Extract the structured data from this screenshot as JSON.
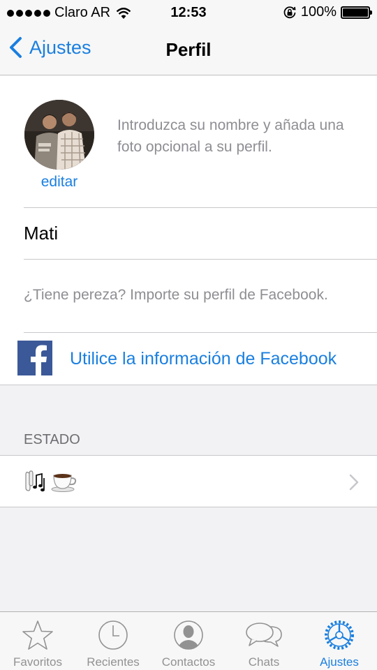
{
  "status_bar": {
    "carrier": "Claro AR",
    "time": "12:53",
    "battery": "100%",
    "battery_level": 1.0,
    "signal_dots": 5
  },
  "nav": {
    "back_label": "Ajustes",
    "title": "Perfil"
  },
  "profile": {
    "edit_label": "editar",
    "hint": "Introduzca su nombre y añada una foto opcional a su perfil.",
    "name_value": "Mati",
    "facebook_hint": "¿Tiene pereza? Importe su perfil de Facebook.",
    "facebook_button": "Utilice la información de Facebook"
  },
  "estado": {
    "header": "ESTADO",
    "value_icons": [
      "earphones-icon",
      "coffee-icon"
    ]
  },
  "tab_bar": {
    "tabs": [
      {
        "label": "Favoritos",
        "icon": "star-icon",
        "active": false
      },
      {
        "label": "Recientes",
        "icon": "clock-icon",
        "active": false
      },
      {
        "label": "Contactos",
        "icon": "contact-icon",
        "active": false
      },
      {
        "label": "Chats",
        "icon": "chat-bubbles-icon",
        "active": false
      },
      {
        "label": "Ajustes",
        "icon": "gear-icon",
        "active": true
      }
    ]
  },
  "colors": {
    "accent": "#1a7fe0",
    "facebook": "#3b5998",
    "secondary_text": "#8e8e93",
    "background": "#f2f2f4"
  }
}
